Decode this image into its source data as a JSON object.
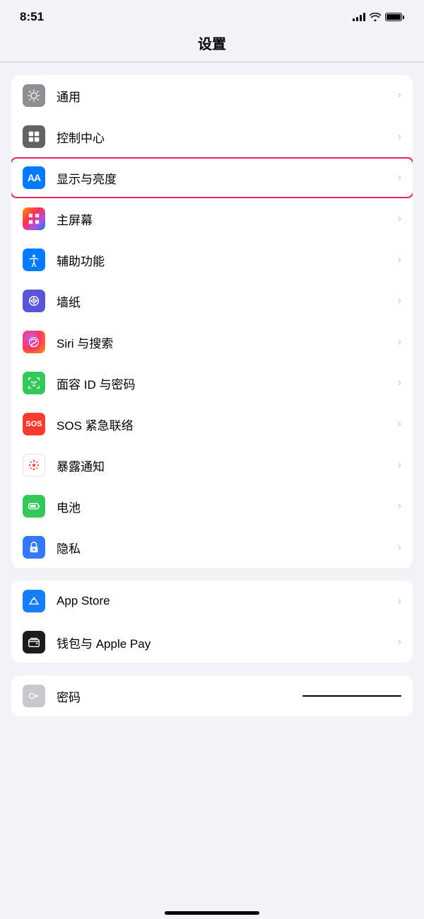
{
  "statusBar": {
    "time": "8:51",
    "batteryFull": true
  },
  "pageTitle": "设置",
  "sections": [
    {
      "id": "main-settings",
      "items": [
        {
          "id": "general",
          "label": "通用",
          "iconColor": "gray",
          "iconType": "gear"
        },
        {
          "id": "control-center",
          "label": "控制中心",
          "iconColor": "gray2",
          "iconType": "sliders"
        },
        {
          "id": "display",
          "label": "显示与亮度",
          "iconColor": "blue",
          "iconType": "aa",
          "highlighted": true
        },
        {
          "id": "home-screen",
          "label": "主屏幕",
          "iconColor": "colorful",
          "iconType": "grid"
        },
        {
          "id": "accessibility",
          "label": "辅助功能",
          "iconColor": "blue2",
          "iconType": "accessibility"
        },
        {
          "id": "wallpaper",
          "label": "墙纸",
          "iconColor": "purple",
          "iconType": "flower"
        },
        {
          "id": "siri",
          "label": "Siri 与搜索",
          "iconColor": "siri",
          "iconType": "siri"
        },
        {
          "id": "faceid",
          "label": "面容 ID 与密码",
          "iconColor": "green",
          "iconType": "faceid"
        },
        {
          "id": "sos",
          "label": "SOS 紧急联络",
          "iconColor": "red",
          "iconType": "sos"
        },
        {
          "id": "exposure",
          "label": "暴露通知",
          "iconColor": "exposure",
          "iconType": "exposure"
        },
        {
          "id": "battery",
          "label": "电池",
          "iconColor": "battery",
          "iconType": "battery"
        },
        {
          "id": "privacy",
          "label": "隐私",
          "iconColor": "privacy",
          "iconType": "hand"
        }
      ]
    },
    {
      "id": "app-settings",
      "items": [
        {
          "id": "appstore",
          "label": "App Store",
          "iconColor": "appstore",
          "iconType": "appstore"
        },
        {
          "id": "wallet",
          "label": "钱包与 Apple Pay",
          "iconColor": "wallet",
          "iconType": "wallet"
        }
      ]
    },
    {
      "id": "passwords-section",
      "items": [
        {
          "id": "passwords",
          "label": "密码",
          "iconColor": "passwords",
          "iconType": "key"
        }
      ]
    }
  ]
}
